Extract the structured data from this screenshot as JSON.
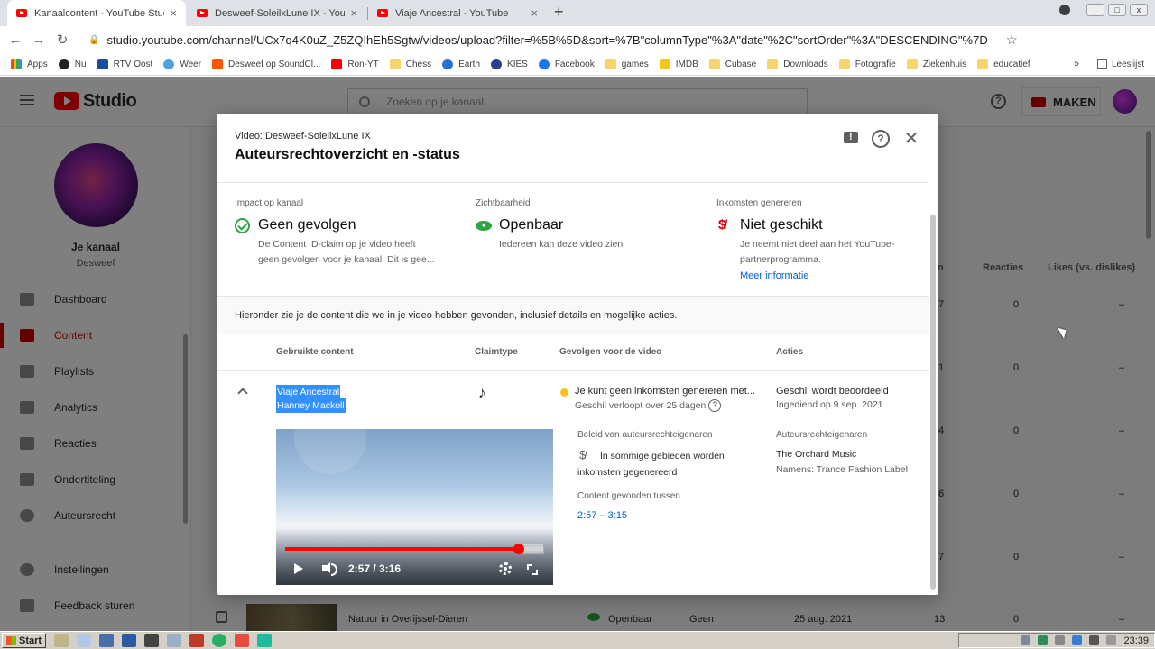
{
  "browser": {
    "tabs": [
      {
        "label": "Kanaalcontent - YouTube Studio",
        "active": true
      },
      {
        "label": "Desweef-SoleilxLune IX - YouTube",
        "active": false
      },
      {
        "label": "Viaje Ancestral - YouTube",
        "active": false
      }
    ],
    "tab_close": "×",
    "new_tab": "+",
    "url": "studio.youtube.com/channel/UCx7q4K0uZ_Z5ZQIhEh5Sgtw/videos/upload?filter=%5B%5D&sort=%7B\"columnType\"%3A\"date\"%2C\"sortOrder\"%3A\"DESCENDING\"%7D",
    "bookmarks": [
      "Apps",
      "Nu",
      "RTV Oost",
      "Weer",
      "Desweef op SoundCl...",
      "Ron-YT",
      "Chess",
      "Earth",
      "KIES",
      "Facebook",
      "games",
      "IMDB",
      "Cubase",
      "Downloads",
      "Fotografie",
      "Ziekenhuis",
      "educatief"
    ],
    "bookmarks_more": "»",
    "reading_list": "Leeslijst"
  },
  "studio": {
    "logo_text": "Studio",
    "search_placeholder": "Zoeken op je kanaal",
    "create_label": "MAKEN",
    "channel_title": "Je kanaal",
    "channel_name": "Desweef",
    "nav": [
      {
        "label": "Dashboard",
        "active": false
      },
      {
        "label": "Content",
        "active": true
      },
      {
        "label": "Playlists",
        "active": false
      },
      {
        "label": "Analytics",
        "active": false
      },
      {
        "label": "Reacties",
        "active": false
      },
      {
        "label": "Ondertiteling",
        "active": false
      },
      {
        "label": "Auteursrecht",
        "active": false
      },
      {
        "label": "Instellingen",
        "active": false
      },
      {
        "label": "Feedback sturen",
        "active": false
      }
    ],
    "table": {
      "col_views_partial": "n",
      "col_comments": "Reacties",
      "col_likes": "Likes (vs. dislikes)",
      "rows": [
        {
          "views": "7",
          "comments": "0",
          "likes": "–"
        },
        {
          "views": "1",
          "comments": "0",
          "likes": "–"
        },
        {
          "views": "4",
          "comments": "0",
          "likes": "–"
        },
        {
          "views": "6",
          "comments": "0",
          "likes": "–"
        },
        {
          "views": "7",
          "comments": "0",
          "likes": "–"
        }
      ],
      "last_row": {
        "title": "Natuur in Overijssel-Dieren",
        "visibility": "Openbaar",
        "restrictions": "Geen",
        "date": "25 aug. 2021",
        "views": "13",
        "comments": "0",
        "likes": "–"
      }
    }
  },
  "dialog": {
    "video_label": "Video: Desweef-SoleilxLune IX",
    "title": "Auteursrechtoverzicht en -status",
    "close_symbol": "✕",
    "help_symbol": "?",
    "summary": [
      {
        "label": "Impact op kanaal",
        "value": "Geen gevolgen",
        "desc": "De Content ID-claim op je video heeft geen gevolgen voor je kanaal. Dit is gee...",
        "link": ""
      },
      {
        "label": "Zichtbaarheid",
        "value": "Openbaar",
        "desc": "Iedereen kan deze video zien",
        "link": ""
      },
      {
        "label": "Inkomsten genereren",
        "value": "Niet geschikt",
        "desc": "Je neemt niet deel aan het YouTube-partnerprogramma.",
        "link": "Meer informatie"
      }
    ],
    "info_text": "Hieronder zie je de content die we in je video hebben gevonden, inclusief details en mogelijke acties.",
    "columns": [
      "Gebruikte content",
      "Claimtype",
      "Gevolgen voor de video",
      "Acties"
    ],
    "claim": {
      "song_title": "Viaje Ancestral",
      "song_artist": "Hanney Mackoll",
      "claim_type_icon": "music-note-icon",
      "effect_main": "Je kunt geen inkomsten genereren met...",
      "effect_sub": "Geschil verloopt over 25 dagen",
      "action_main": "Geschil wordt beoordeeld",
      "action_sub": "Ingediend op 9 sep. 2021",
      "player_time": "2:57 / 3:16",
      "progress": 0.903,
      "policy_label": "Beleid van auteursrechteigenaren",
      "policy_text": "In sommige gebieden worden inkomsten gegenereerd",
      "found_label": "Content gevonden tussen",
      "found_range": "2:57 – 3:15",
      "owners_label": "Auteursrechteigenaren",
      "owner_name": "The Orchard Music",
      "owner_on_behalf": "Namens: Trance Fashion Label"
    }
  },
  "taskbar": {
    "start_label": "Start",
    "clock": "23:39"
  }
}
